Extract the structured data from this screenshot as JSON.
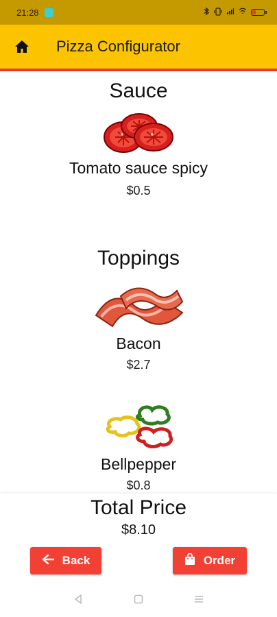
{
  "status_bar": {
    "time": "21:28",
    "battery_level": "11",
    "icons": [
      "bluetooth-icon",
      "vibrate-icon",
      "signal-icon",
      "wifi-icon",
      "battery-icon"
    ]
  },
  "app_bar": {
    "title": "Pizza Configurator",
    "home_icon": "home-icon",
    "background": "#fcc400",
    "accent": "#e53b2c"
  },
  "sections": {
    "sauce": {
      "heading": "Sauce",
      "items": [
        {
          "name": "Tomato sauce spicy",
          "price": "$0.5",
          "icon": "tomato-slices-icon"
        }
      ]
    },
    "toppings": {
      "heading": "Toppings",
      "items": [
        {
          "name": "Bacon",
          "price": "$2.7",
          "icon": "bacon-icon"
        },
        {
          "name": "Bellpepper",
          "price": "$0.8",
          "icon": "bellpepper-icon"
        }
      ]
    }
  },
  "footer": {
    "total_label": "Total Price",
    "total_value": "$8.10",
    "back_label": "Back",
    "order_label": "Order",
    "button_color": "#f24134"
  },
  "nav_bar": {
    "icons": [
      "back-triangle-icon",
      "home-square-icon",
      "menu-lines-icon"
    ]
  }
}
